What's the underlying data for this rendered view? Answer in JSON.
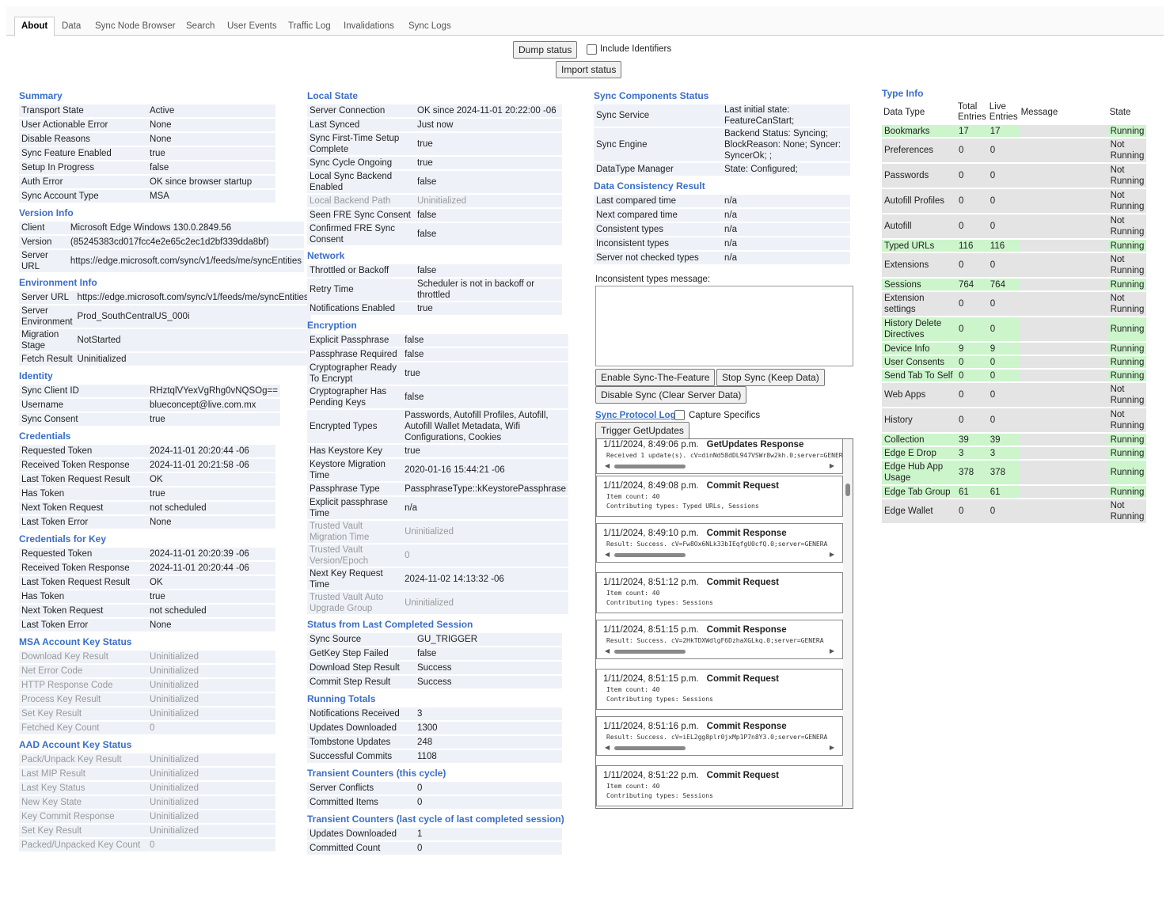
{
  "tabs": [
    "About",
    "Data",
    "Sync Node Browser",
    "Search",
    "User Events",
    "Traffic Log",
    "Invalidations",
    "Sync Logs"
  ],
  "controls": {
    "dump_status": "Dump status",
    "include_identifiers": "Include Identifiers",
    "import_status": "Import status",
    "enable_sync": "Enable Sync-The-Feature",
    "stop_sync": "Stop Sync (Keep Data)",
    "disable_sync": "Disable Sync (Clear Server Data)",
    "protocol_log": "Sync Protocol Log",
    "capture_specifics": "Capture Specifics",
    "trigger_getupdates": "Trigger GetUpdates",
    "inconsistent_msg_label": "Inconsistent types message:"
  },
  "col1": [
    {
      "title": "Summary",
      "rows": [
        [
          "Transport State",
          "Active"
        ],
        [
          "User Actionable Error",
          "None"
        ],
        [
          "Disable Reasons",
          "None"
        ],
        [
          "Sync Feature Enabled",
          "true"
        ],
        [
          "Setup In Progress",
          "false"
        ],
        [
          "Auth Error",
          "OK since browser startup"
        ],
        [
          "Sync Account Type",
          "MSA"
        ]
      ]
    },
    {
      "title": "Version Info",
      "rows": [
        [
          "Client",
          "Microsoft Edge Windows 130.0.2849.56"
        ],
        [
          "Version",
          "(85245383cd017fcc4e2e65c2ec1d2bf339dda8bf)"
        ],
        [
          "Server URL",
          "https://edge.microsoft.com/sync/v1/feeds/me/syncEntities"
        ]
      ]
    },
    {
      "title": "Environment Info",
      "rows": [
        [
          "Server URL",
          "https://edge.microsoft.com/sync/v1/feeds/me/syncEntities"
        ],
        [
          "Server Environment",
          "Prod_SouthCentralUS_000i"
        ],
        [
          "Migration Stage",
          "NotStarted"
        ],
        [
          "Fetch Result",
          "Uninitialized"
        ]
      ]
    },
    {
      "title": "Identity",
      "rows": [
        [
          "Sync Client ID",
          "RHztqlVYexVgRhg0vNQSOg=="
        ],
        [
          "Username",
          "blueconcept@live.com.mx"
        ],
        [
          "Sync Consent",
          "true"
        ]
      ]
    },
    {
      "title": "Credentials",
      "rows": [
        [
          "Requested Token",
          "2024-11-01 20:20:44 -06"
        ],
        [
          "Received Token Response",
          "2024-11-01 20:21:58 -06"
        ],
        [
          "Last Token Request Result",
          "OK"
        ],
        [
          "Has Token",
          "true"
        ],
        [
          "Next Token Request",
          "not scheduled"
        ],
        [
          "Last Token Error",
          "None"
        ]
      ]
    },
    {
      "title": "Credentials for Key",
      "rows": [
        [
          "Requested Token",
          "2024-11-01 20:20:39 -06"
        ],
        [
          "Received Token Response",
          "2024-11-01 20:20:44 -06"
        ],
        [
          "Last Token Request Result",
          "OK"
        ],
        [
          "Has Token",
          "true"
        ],
        [
          "Next Token Request",
          "not scheduled"
        ],
        [
          "Last Token Error",
          "None"
        ]
      ]
    },
    {
      "title": "MSA Account Key Status",
      "dim": true,
      "rows": [
        [
          "Download Key Result",
          "Uninitialized"
        ],
        [
          "Net Error Code",
          "Uninitialized"
        ],
        [
          "HTTP Response Code",
          "Uninitialized"
        ],
        [
          "Process Key Result",
          "Uninitialized"
        ],
        [
          "Set Key Result",
          "Uninitialized"
        ],
        [
          "Fetched Key Count",
          "0"
        ]
      ]
    },
    {
      "title": "AAD Account Key Status",
      "dim": true,
      "rows": [
        [
          "Pack/Unpack Key Result",
          "Uninitialized"
        ],
        [
          "Last MIP Result",
          "Uninitialized"
        ],
        [
          "Last Key Status",
          "Uninitialized"
        ],
        [
          "New Key State",
          "Uninitialized"
        ],
        [
          "Key Commit Response",
          "Uninitialized"
        ],
        [
          "Set Key Result",
          "Uninitialized"
        ],
        [
          "Packed/Unpacked Key Count",
          "0"
        ]
      ]
    }
  ],
  "col2": [
    {
      "title": "Local State",
      "rows": [
        [
          "Server Connection",
          "OK since 2024-11-01 20:22:00 -06"
        ],
        [
          "Last Synced",
          "Just now"
        ],
        [
          "Sync First-Time Setup Complete",
          "true"
        ],
        [
          "Sync Cycle Ongoing",
          "true"
        ],
        [
          "Local Sync Backend Enabled",
          "false"
        ],
        [
          "Local Backend Path",
          "Uninitialized",
          "dim"
        ],
        [
          "Seen FRE Sync Consent",
          "false"
        ],
        [
          "Confirmed FRE Sync Consent",
          "false"
        ]
      ]
    },
    {
      "title": "Network",
      "rows": [
        [
          "Throttled or Backoff",
          "false"
        ],
        [
          "Retry Time",
          "Scheduler is not in backoff or throttled"
        ],
        [
          "Notifications Enabled",
          "true"
        ]
      ]
    },
    {
      "title": "Encryption",
      "rows": [
        [
          "Explicit Passphrase",
          "false"
        ],
        [
          "Passphrase Required",
          "false"
        ],
        [
          "Cryptographer Ready To Encrypt",
          "true"
        ],
        [
          "Cryptographer Has Pending Keys",
          "false"
        ],
        [
          "Encrypted Types",
          "Passwords, Autofill Profiles, Autofill, Autofill Wallet Metadata, Wifi Configurations, Cookies"
        ],
        [
          "Has Keystore Key",
          "true"
        ],
        [
          "Keystore Migration Time",
          "2020-01-16 15:44:21 -06"
        ],
        [
          "Passphrase Type",
          "PassphraseType::kKeystorePassphrase"
        ],
        [
          "Explicit passphrase Time",
          "n/a"
        ],
        [
          "Trusted Vault Migration Time",
          "Uninitialized",
          "dim"
        ],
        [
          "Trusted Vault Version/Epoch",
          "0",
          "dim"
        ],
        [
          "Next Key Request Time",
          "2024-11-02 14:13:32 -06"
        ],
        [
          "Trusted Vault Auto Upgrade Group",
          "Uninitialized",
          "dim"
        ]
      ]
    },
    {
      "title": "Status from Last Completed Session",
      "rows": [
        [
          "Sync Source",
          "GU_TRIGGER"
        ],
        [
          "GetKey Step Failed",
          "false"
        ],
        [
          "Download Step Result",
          "Success"
        ],
        [
          "Commit Step Result",
          "Success"
        ]
      ]
    },
    {
      "title": "Running Totals",
      "rows": [
        [
          "Notifications Received",
          "3"
        ],
        [
          "Updates Downloaded",
          "1300"
        ],
        [
          "Tombstone Updates",
          "248"
        ],
        [
          "Successful Commits",
          "1108"
        ]
      ]
    },
    {
      "title": "Transient Counters (this cycle)",
      "rows": [
        [
          "Server Conflicts",
          "0"
        ],
        [
          "Committed Items",
          "0"
        ]
      ]
    },
    {
      "title": "Transient Counters (last cycle of last completed session)",
      "rows": [
        [
          "Updates Downloaded",
          "1"
        ],
        [
          "Committed Count",
          "0"
        ]
      ]
    }
  ],
  "col3": [
    {
      "title": "Sync Components Status",
      "rows": [
        [
          "Sync Service",
          "Last initial state: FeatureCanStart;"
        ],
        [
          "Sync Engine",
          "Backend Status: Syncing; BlockReason: None; Syncer: SyncerOk; ;"
        ],
        [
          "DataType Manager",
          "State: Configured;"
        ]
      ]
    },
    {
      "title": "Data Consistency Result",
      "rows": [
        [
          "Last compared time",
          "n/a"
        ],
        [
          "Next compared time",
          "n/a"
        ],
        [
          "Consistent types",
          "n/a"
        ],
        [
          "Inconsistent types",
          "n/a"
        ],
        [
          "Server not checked types",
          "n/a"
        ]
      ]
    }
  ],
  "log_entries": [
    {
      "time": "1/11/2024, 8:49:06 p.m.",
      "kind": "GetUpdates Response",
      "body": "Received 1 update(s). cV=dinNd58dDL947VSWr8w2kh.0;server=GENERA",
      "scroll": true
    },
    {
      "time": "1/11/2024, 8:49:08 p.m.",
      "kind": "Commit Request",
      "body": "Item count: 40\nContributing types: Typed URLs, Sessions",
      "scroll": false
    },
    {
      "time": "1/11/2024, 8:49:10 p.m.",
      "kind": "Commit Response",
      "body": "Result: Success. cV=Fw8Ox6NLk33bIEqfgU0cfQ.0;server=GENERA",
      "scroll": true
    },
    {
      "time": "1/11/2024, 8:51:12 p.m.",
      "kind": "Commit Request",
      "body": "Item count: 40\nContributing types: Sessions",
      "scroll": false
    },
    {
      "time": "1/11/2024, 8:51:15 p.m.",
      "kind": "Commit Response",
      "body": "Result: Success. cV=2HkTDXWdlgF6DzhaXGLkq.0;server=GENERA",
      "scroll": true
    },
    {
      "time": "1/11/2024, 8:51:15 p.m.",
      "kind": "Commit Request",
      "body": "Item count: 40\nContributing types: Sessions",
      "scroll": false
    },
    {
      "time": "1/11/2024, 8:51:16 p.m.",
      "kind": "Commit Response",
      "body": "Result: Success. cV=iEL2gg8plr0jxMp1P7n8Y3.0;server=GENERA",
      "scroll": true
    },
    {
      "time": "1/11/2024, 8:51:22 p.m.",
      "kind": "Commit Request",
      "body": "Item count: 40\nContributing types: Sessions",
      "scroll": false
    }
  ],
  "type_info": {
    "title": "Type Info",
    "headers": [
      "Data Type",
      "Total Entries",
      "Live Entries",
      "Message",
      "State"
    ],
    "rows": [
      [
        "Bookmarks",
        "17",
        "17",
        "",
        "Running"
      ],
      [
        "Preferences",
        "0",
        "0",
        "",
        "Not Running"
      ],
      [
        "Passwords",
        "0",
        "0",
        "",
        "Not Running"
      ],
      [
        "Autofill Profiles",
        "0",
        "0",
        "",
        "Not Running"
      ],
      [
        "Autofill",
        "0",
        "0",
        "",
        "Not Running"
      ],
      [
        "Typed URLs",
        "116",
        "116",
        "",
        "Running"
      ],
      [
        "Extensions",
        "0",
        "0",
        "",
        "Not Running"
      ],
      [
        "Sessions",
        "764",
        "764",
        "",
        "Running"
      ],
      [
        "Extension settings",
        "0",
        "0",
        "",
        "Not Running"
      ],
      [
        "History Delete Directives",
        "0",
        "0",
        "",
        "Running"
      ],
      [
        "Device Info",
        "9",
        "9",
        "",
        "Running"
      ],
      [
        "User Consents",
        "0",
        "0",
        "",
        "Running"
      ],
      [
        "Send Tab To Self",
        "0",
        "0",
        "",
        "Running"
      ],
      [
        "Web Apps",
        "0",
        "0",
        "",
        "Not Running"
      ],
      [
        "History",
        "0",
        "0",
        "",
        "Not Running"
      ],
      [
        "Collection",
        "39",
        "39",
        "",
        "Running"
      ],
      [
        "Edge E Drop",
        "3",
        "3",
        "",
        "Running"
      ],
      [
        "Edge Hub App Usage",
        "378",
        "378",
        "",
        "Running"
      ],
      [
        "Edge Tab Group",
        "61",
        "61",
        "",
        "Running"
      ],
      [
        "Edge Wallet",
        "0",
        "0",
        "",
        "Not Running"
      ]
    ]
  }
}
